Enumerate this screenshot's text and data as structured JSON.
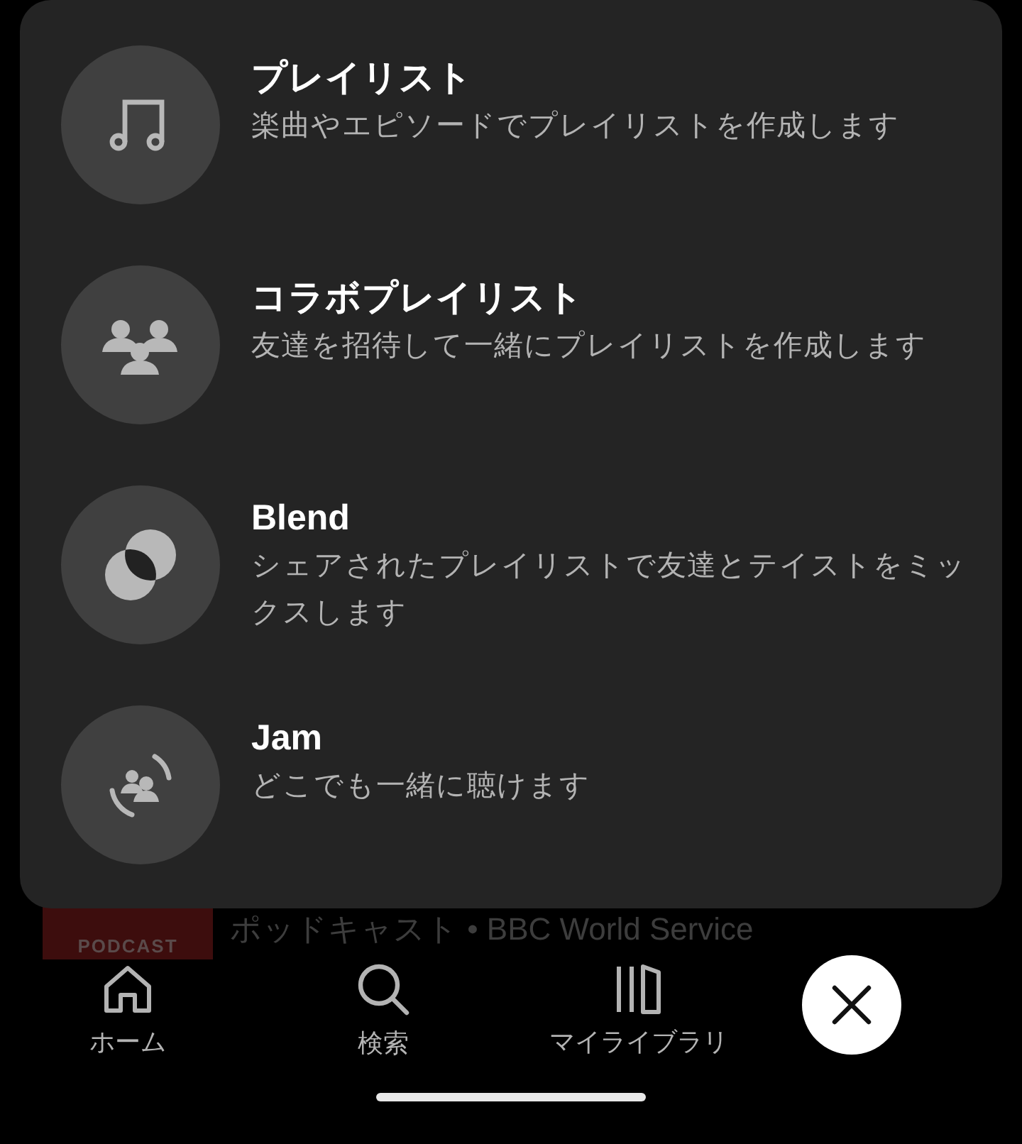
{
  "menu": {
    "items": [
      {
        "kind": "playlist",
        "title": "プレイリスト",
        "description": "楽曲やエピソードでプレイリストを作成します"
      },
      {
        "kind": "collab",
        "title": "コラボプレイリスト",
        "description": "友達を招待して一緒にプレイリストを作成します"
      },
      {
        "kind": "blend",
        "title": "Blend",
        "description": "シェアされたプレイリストで友達とテイストをミックスします"
      },
      {
        "kind": "jam",
        "title": "Jam",
        "description": "どこでも一緒に聴けます"
      }
    ]
  },
  "background_row": {
    "thumbnail_label": "PODCAST",
    "subtitle": "ポッドキャスト • BBC World Service"
  },
  "nav": {
    "items": [
      {
        "kind": "home",
        "label": "ホーム"
      },
      {
        "kind": "search",
        "label": "検索"
      },
      {
        "kind": "library",
        "label": "マイライブラリ"
      }
    ]
  }
}
